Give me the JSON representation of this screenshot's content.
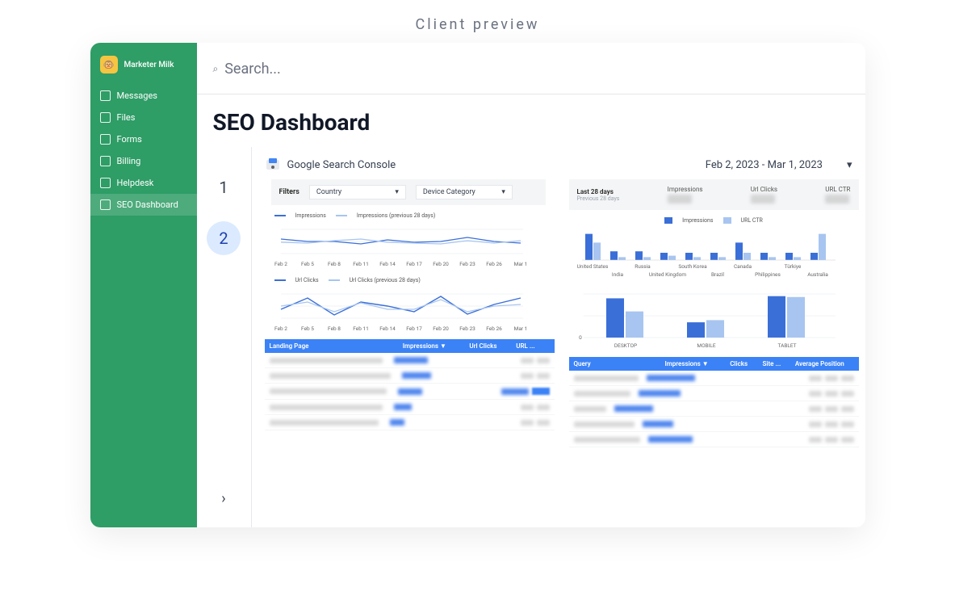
{
  "preview_label": "Client preview",
  "brand": {
    "name": "Marketer Milk",
    "logo_glyph": "🐵"
  },
  "sidebar": {
    "items": [
      {
        "label": "Messages",
        "icon": "message-icon"
      },
      {
        "label": "Files",
        "icon": "folder-icon"
      },
      {
        "label": "Forms",
        "icon": "clipboard-icon"
      },
      {
        "label": "Billing",
        "icon": "card-icon"
      },
      {
        "label": "Helpdesk",
        "icon": "book-icon"
      },
      {
        "label": "SEO Dashboard",
        "icon": "presentation-icon"
      }
    ],
    "active_index": 5
  },
  "search": {
    "placeholder": "Search..."
  },
  "page_title": "SEO Dashboard",
  "steps": {
    "s1": "1",
    "s2": "2",
    "arrow": "›"
  },
  "dashboard": {
    "source_title": "Google Search Console",
    "date_range": "Feb 2, 2023 - Mar 1, 2023",
    "filters_label": "Filters",
    "filter1": "Country",
    "filter2": "Device Category",
    "period_label": "Last 28 days",
    "period_sub": "Previous 28 days",
    "kpis": [
      {
        "label": "Impressions"
      },
      {
        "label": "Url Clicks"
      },
      {
        "label": "URL CTR"
      }
    ],
    "impressions_legend": {
      "a": "Impressions",
      "b": "Impressions (previous 28 days)"
    },
    "clicks_legend": {
      "a": "Url Clicks",
      "b": "Url Clicks (previous 28 days)"
    },
    "bar_legend": {
      "a": "Impressions",
      "b": "URL CTR"
    },
    "x_dates": [
      "Feb 2",
      "Feb 5",
      "Feb 8",
      "Feb 11",
      "Feb 14",
      "Feb 17",
      "Feb 20",
      "Feb 23",
      "Feb 26",
      "Mar 1"
    ],
    "countries_top": [
      "United States",
      "",
      "Russia",
      "",
      "South Korea",
      "",
      "Canada",
      "",
      "Türkiye",
      ""
    ],
    "countries_bottom": [
      "",
      "India",
      "",
      "United Kingdom",
      "",
      "Brazil",
      "",
      "Philippines",
      "",
      "Australia"
    ],
    "devices": [
      "DESKTOP",
      "MOBILE",
      "TABLET"
    ],
    "table_left": {
      "headers": [
        "Landing Page",
        "Impressions ▼",
        "Url Clicks",
        "URL ..."
      ]
    },
    "table_right": {
      "headers": [
        "Query",
        "Impressions ▼",
        "Clicks",
        "Site ...",
        "Average Position"
      ]
    }
  },
  "chart_data": [
    {
      "type": "line",
      "title": "Impressions over time",
      "xlabel": "",
      "ylabel": "",
      "categories": [
        "Feb 2",
        "Feb 5",
        "Feb 8",
        "Feb 11",
        "Feb 14",
        "Feb 17",
        "Feb 20",
        "Feb 23",
        "Feb 26",
        "Mar 1"
      ],
      "series": [
        {
          "name": "Impressions",
          "values": [
            58,
            53,
            52,
            47,
            55,
            50,
            53,
            60,
            52,
            48
          ]
        },
        {
          "name": "Impressions (previous 28 days)",
          "values": [
            52,
            50,
            54,
            57,
            52,
            50,
            49,
            55,
            50,
            55
          ]
        }
      ],
      "ylim": [
        0,
        100
      ]
    },
    {
      "type": "line",
      "title": "Url Clicks over time",
      "xlabel": "",
      "ylabel": "",
      "categories": [
        "Feb 2",
        "Feb 5",
        "Feb 8",
        "Feb 11",
        "Feb 14",
        "Feb 17",
        "Feb 20",
        "Feb 23",
        "Feb 26",
        "Mar 1"
      ],
      "series": [
        {
          "name": "Url Clicks",
          "values": [
            48,
            70,
            35,
            63,
            55,
            40,
            74,
            38,
            57,
            70
          ]
        },
        {
          "name": "Url Clicks (previous 28 days)",
          "values": [
            55,
            62,
            42,
            60,
            48,
            47,
            68,
            42,
            55,
            58
          ]
        }
      ],
      "ylim": [
        0,
        100
      ]
    },
    {
      "type": "bar",
      "title": "By Country",
      "xlabel": "",
      "ylabel": "",
      "categories": [
        "United States",
        "India",
        "Russia",
        "United Kingdom",
        "South Korea",
        "Brazil",
        "Canada",
        "Philippines",
        "Türkiye",
        "Australia"
      ],
      "series": [
        {
          "name": "Impressions",
          "values": [
            90,
            30,
            30,
            25,
            25,
            25,
            60,
            25,
            25,
            25
          ]
        },
        {
          "name": "URL CTR",
          "values": [
            60,
            10,
            10,
            15,
            10,
            10,
            25,
            10,
            10,
            90
          ]
        }
      ],
      "ylim": [
        0,
        100
      ]
    },
    {
      "type": "bar",
      "title": "By Device",
      "xlabel": "",
      "ylabel": "",
      "categories": [
        "DESKTOP",
        "MOBILE",
        "TABLET"
      ],
      "series": [
        {
          "name": "Impressions",
          "values": [
            90,
            35,
            95
          ]
        },
        {
          "name": "URL CTR",
          "values": [
            60,
            40,
            93
          ]
        }
      ],
      "ylim": [
        0,
        100
      ]
    }
  ]
}
